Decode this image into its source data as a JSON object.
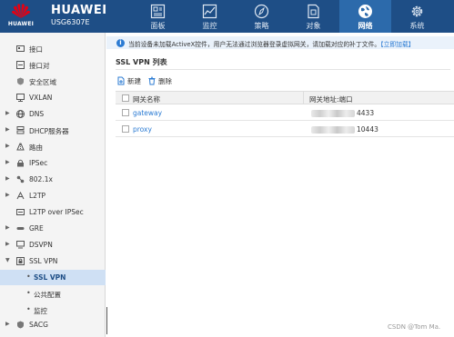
{
  "header": {
    "logo_text": "HUAWEI",
    "brand": "HUAWEI",
    "model": "USG6307E",
    "nav": [
      {
        "label": "面板",
        "icon": "dashboard-icon",
        "active": false
      },
      {
        "label": "监控",
        "icon": "monitor-icon",
        "active": false
      },
      {
        "label": "策略",
        "icon": "policy-compass-icon",
        "active": false
      },
      {
        "label": "对象",
        "icon": "object-icon",
        "active": false
      },
      {
        "label": "网络",
        "icon": "network-globe-icon",
        "active": true
      },
      {
        "label": "系统",
        "icon": "system-gear-icon",
        "active": false
      }
    ]
  },
  "sidebar": {
    "items": [
      {
        "label": "接口",
        "expandable": false,
        "icon": "interface-icon"
      },
      {
        "label": "接口对",
        "expandable": false,
        "icon": "interface-pair-icon"
      },
      {
        "label": "安全区域",
        "expandable": false,
        "icon": "security-zone-icon"
      },
      {
        "label": "VXLAN",
        "expandable": false,
        "icon": "vxlan-icon"
      },
      {
        "label": "DNS",
        "expandable": true,
        "icon": "dns-icon"
      },
      {
        "label": "DHCP服务器",
        "expandable": true,
        "icon": "dhcp-icon"
      },
      {
        "label": "路由",
        "expandable": true,
        "icon": "route-icon"
      },
      {
        "label": "IPSec",
        "expandable": true,
        "icon": "ipsec-icon"
      },
      {
        "label": "802.1x",
        "expandable": true,
        "icon": "dot1x-icon"
      },
      {
        "label": "L2TP",
        "expandable": true,
        "icon": "l2tp-icon"
      },
      {
        "label": "L2TP over IPSec",
        "expandable": false,
        "icon": "l2tp-ipsec-icon"
      },
      {
        "label": "GRE",
        "expandable": true,
        "icon": "gre-icon"
      },
      {
        "label": "DSVPN",
        "expandable": true,
        "icon": "dsvpn-icon"
      },
      {
        "label": "SSL VPN",
        "expandable": true,
        "expanded": true,
        "icon": "sslvpn-icon"
      }
    ],
    "sub_items": [
      {
        "label": "SSL VPN",
        "selected": true
      },
      {
        "label": "公共配置",
        "selected": false
      },
      {
        "label": "监控",
        "selected": false
      }
    ],
    "last_item": {
      "label": "SACG",
      "icon": "sacg-icon"
    }
  },
  "notice": {
    "text": "当前设备未加载ActiveX控件，用户无法通过浏览器登录虚拟网关，请加载对应的补丁文件。",
    "link": "【立即加载】"
  },
  "main": {
    "title": "SSL VPN 列表",
    "toolbar": {
      "new_label": "新建",
      "delete_label": "删除"
    },
    "columns": [
      "网关名称",
      "网关地址:端口"
    ],
    "rows": [
      {
        "name": "gateway",
        "port_suffix": "4433"
      },
      {
        "name": "proxy",
        "port_suffix": "10443"
      }
    ]
  },
  "watermark": "CSDN @Tom Ma.",
  "colors": {
    "header": "#1e4e86",
    "active_nav": "#2c6aab",
    "link": "#2b7bd3",
    "selected": "#cfe0f4"
  }
}
